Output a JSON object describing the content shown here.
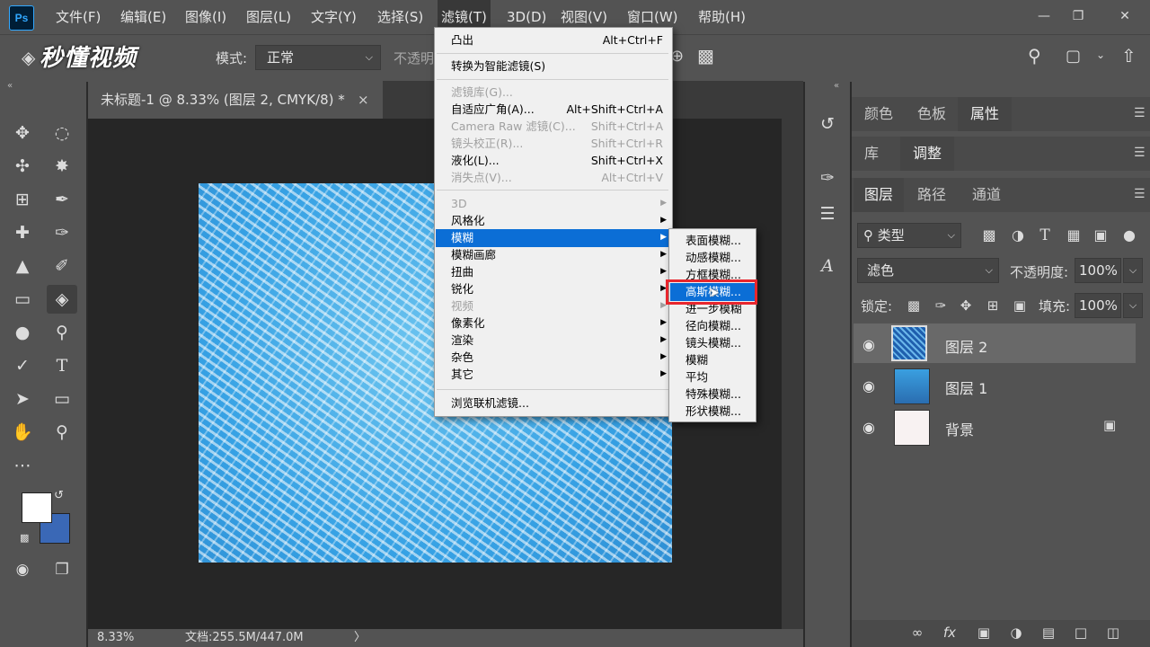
{
  "menubar": {
    "logo": "Ps",
    "items": [
      "文件(F)",
      "编辑(E)",
      "图像(I)",
      "图层(L)",
      "文字(Y)",
      "选择(S)",
      "滤镜(T)",
      "3D(D)",
      "视图(V)",
      "窗口(W)",
      "帮助(H)"
    ],
    "active_index": 6
  },
  "options": {
    "mode_label": "模式:",
    "mode_value": "正常",
    "opacity_label": "不透明",
    "watermark": "秒懂视频"
  },
  "document": {
    "tab_title": "未标题-1 @ 8.33% (图层 2, CMYK/8) *",
    "close": "×"
  },
  "status": {
    "zoom": "8.33%",
    "doc_size": "文档:255.5M/447.0M",
    "arrow": "〉"
  },
  "filter_menu": {
    "items": [
      {
        "label": "凸出",
        "shortcut": "Alt+Ctrl+F",
        "disabled": false
      },
      {
        "label": "转换为智能滤镜(S)",
        "shortcut": "",
        "disabled": false
      },
      {
        "label": "滤镜库(G)...",
        "shortcut": "",
        "disabled": true
      },
      {
        "label": "自适应广角(A)...",
        "shortcut": "Alt+Shift+Ctrl+A",
        "disabled": false
      },
      {
        "label": "Camera Raw 滤镜(C)...",
        "shortcut": "Shift+Ctrl+A",
        "disabled": true
      },
      {
        "label": "镜头校正(R)...",
        "shortcut": "Shift+Ctrl+R",
        "disabled": true
      },
      {
        "label": "液化(L)...",
        "shortcut": "Shift+Ctrl+X",
        "disabled": false
      },
      {
        "label": "消失点(V)...",
        "shortcut": "Alt+Ctrl+V",
        "disabled": true
      },
      {
        "label": "3D",
        "submenu": true,
        "disabled": true
      },
      {
        "label": "风格化",
        "submenu": true,
        "disabled": false
      },
      {
        "label": "模糊",
        "submenu": true,
        "disabled": false,
        "highlighted": true
      },
      {
        "label": "模糊画廊",
        "submenu": true,
        "disabled": false
      },
      {
        "label": "扭曲",
        "submenu": true,
        "disabled": false
      },
      {
        "label": "锐化",
        "submenu": true,
        "disabled": false
      },
      {
        "label": "视频",
        "submenu": true,
        "disabled": true
      },
      {
        "label": "像素化",
        "submenu": true,
        "disabled": false
      },
      {
        "label": "渲染",
        "submenu": true,
        "disabled": false
      },
      {
        "label": "杂色",
        "submenu": true,
        "disabled": false
      },
      {
        "label": "其它",
        "submenu": true,
        "disabled": false
      },
      {
        "label": "浏览联机滤镜...",
        "shortcut": "",
        "disabled": false
      }
    ]
  },
  "blur_menu": {
    "items": [
      "表面模糊...",
      "动感模糊...",
      "方框模糊...",
      "高斯模糊...",
      "进一步模糊",
      "径向模糊...",
      "镜头模糊...",
      "模糊",
      "平均",
      "特殊模糊...",
      "形状模糊..."
    ],
    "highlighted_index": 3
  },
  "right_panel": {
    "tabs_row1": [
      "颜色",
      "色板",
      "属性"
    ],
    "tabs_row2": [
      "库",
      "调整"
    ],
    "tabs_row3": [
      "图层",
      "路径",
      "通道"
    ],
    "kind_filter": "类型",
    "blend_mode": "滤色",
    "opacity_label": "不透明度:",
    "opacity_value": "100%",
    "lock_label": "锁定:",
    "fill_label": "填充:",
    "fill_value": "100%",
    "layers": [
      {
        "name": "图层 2",
        "selected": true
      },
      {
        "name": "图层 1",
        "selected": false
      },
      {
        "name": "背景",
        "selected": false,
        "locked": true
      }
    ]
  },
  "colors": {
    "foreground": "#ffffff",
    "background": "#3a68b6",
    "highlight": "#0b6ed6",
    "callout": "#e8262d"
  }
}
